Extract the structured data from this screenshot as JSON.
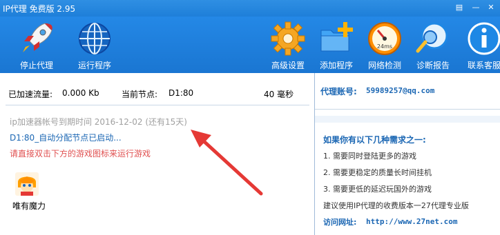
{
  "window": {
    "title": "IP代理 免费版 2.95"
  },
  "toolbar": {
    "stop_proxy": "停止代理",
    "run_program": "运行程序",
    "advanced_settings": "高级设置",
    "add_program": "添加程序",
    "network_test": "网络检测",
    "diagnostic_report": "诊断报告",
    "contact_support": "联系客服",
    "speed_label": "24ms"
  },
  "stats": {
    "traffic_label": "已加速流量:",
    "traffic_value": "0.000 Kb",
    "node_label": "当前节点:",
    "node_value": "D1:80",
    "latency_value": "40 毫秒"
  },
  "status": {
    "expire": "ip加速器帐号到期时间 2016-12-02 (还有15天)",
    "node_started": "D1:80_自动分配节点已启动...",
    "hint": "请直接双击下方的游戏图标来运行游戏"
  },
  "game": {
    "name": "唯有魔力"
  },
  "account": {
    "label": "代理账号:",
    "value": "59989257@qq.com"
  },
  "promo": {
    "heading": "如果你有以下几种需求之一:",
    "items": [
      "1. 需要同时登陆更多的游戏",
      "2. 需要更稳定的质量长时间挂机",
      "3. 需要更低的延迟玩国外的游戏"
    ],
    "recommend": "建议使用IP代理的收费版本一27代理专业版",
    "site_label": "访问网址:",
    "site_url": "http://www.27net.com"
  },
  "colors": {
    "toolbar": "#1e7fd9",
    "link": "#1a66b3",
    "hint": "#e05050",
    "arrow": "#e53935"
  }
}
